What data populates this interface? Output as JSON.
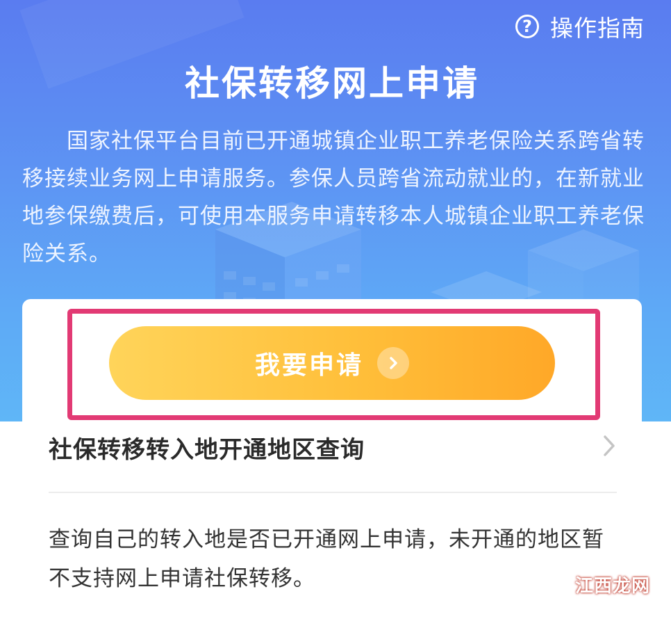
{
  "header": {
    "guide_label": "操作指南",
    "title": "社保转移网上申请",
    "description": "国家社保平台目前已开通城镇企业职工养老保险关系跨省转移接续业务网上申请服务。参保人员跨省流动就业的，在新就业地参保缴费后，可使用本服务申请转移本人城镇企业职工养老保险关系。"
  },
  "apply": {
    "button_label": "我要申请"
  },
  "query": {
    "title": "社保转移转入地开通地区查询",
    "description": "查询自己的转入地是否已开通网上申请，未开通的地区暂不支持网上申请社保转移。"
  },
  "watermark": "江西龙网",
  "colors": {
    "hero_top": "#5a7cf0",
    "hero_bottom": "#5fb6f7",
    "button_start": "#ffd45a",
    "button_end": "#ffa828",
    "highlight_border": "#e23a74"
  },
  "icons": {
    "guide": "question-circle-icon",
    "apply_arrow": "chevron-right-circle-icon",
    "query_arrow": "chevron-right-icon"
  }
}
